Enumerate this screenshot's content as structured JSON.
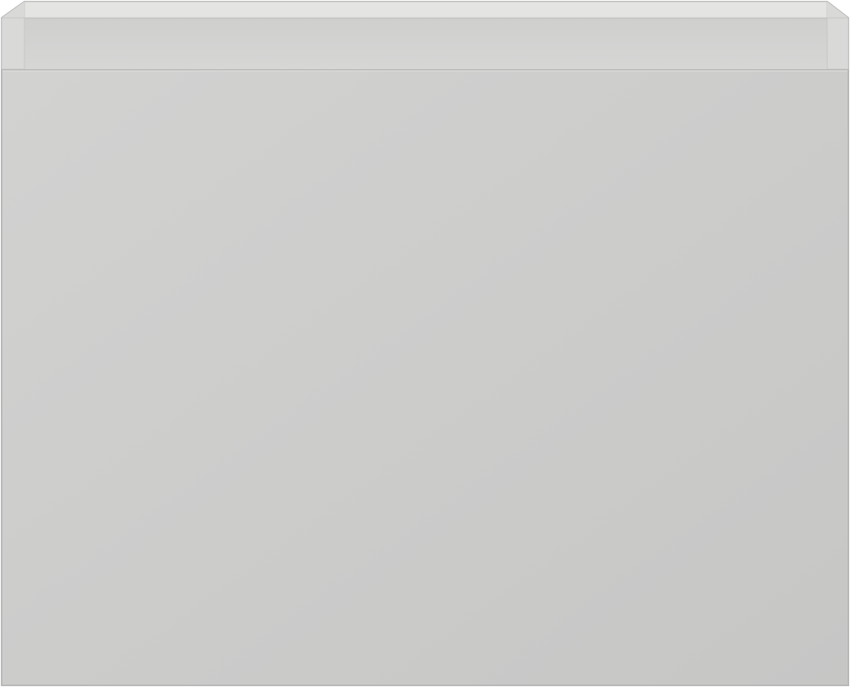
{
  "object": {
    "kind": "wall-mounted cabinet drawer unit",
    "colors": {
      "front": "#cfcfce",
      "front_shadow": "#c4c4c3",
      "frame": "#d6d6d5",
      "frame_inner": "#dcdcdb",
      "edge": "#b8b8b7",
      "background": "#ffffff"
    }
  }
}
